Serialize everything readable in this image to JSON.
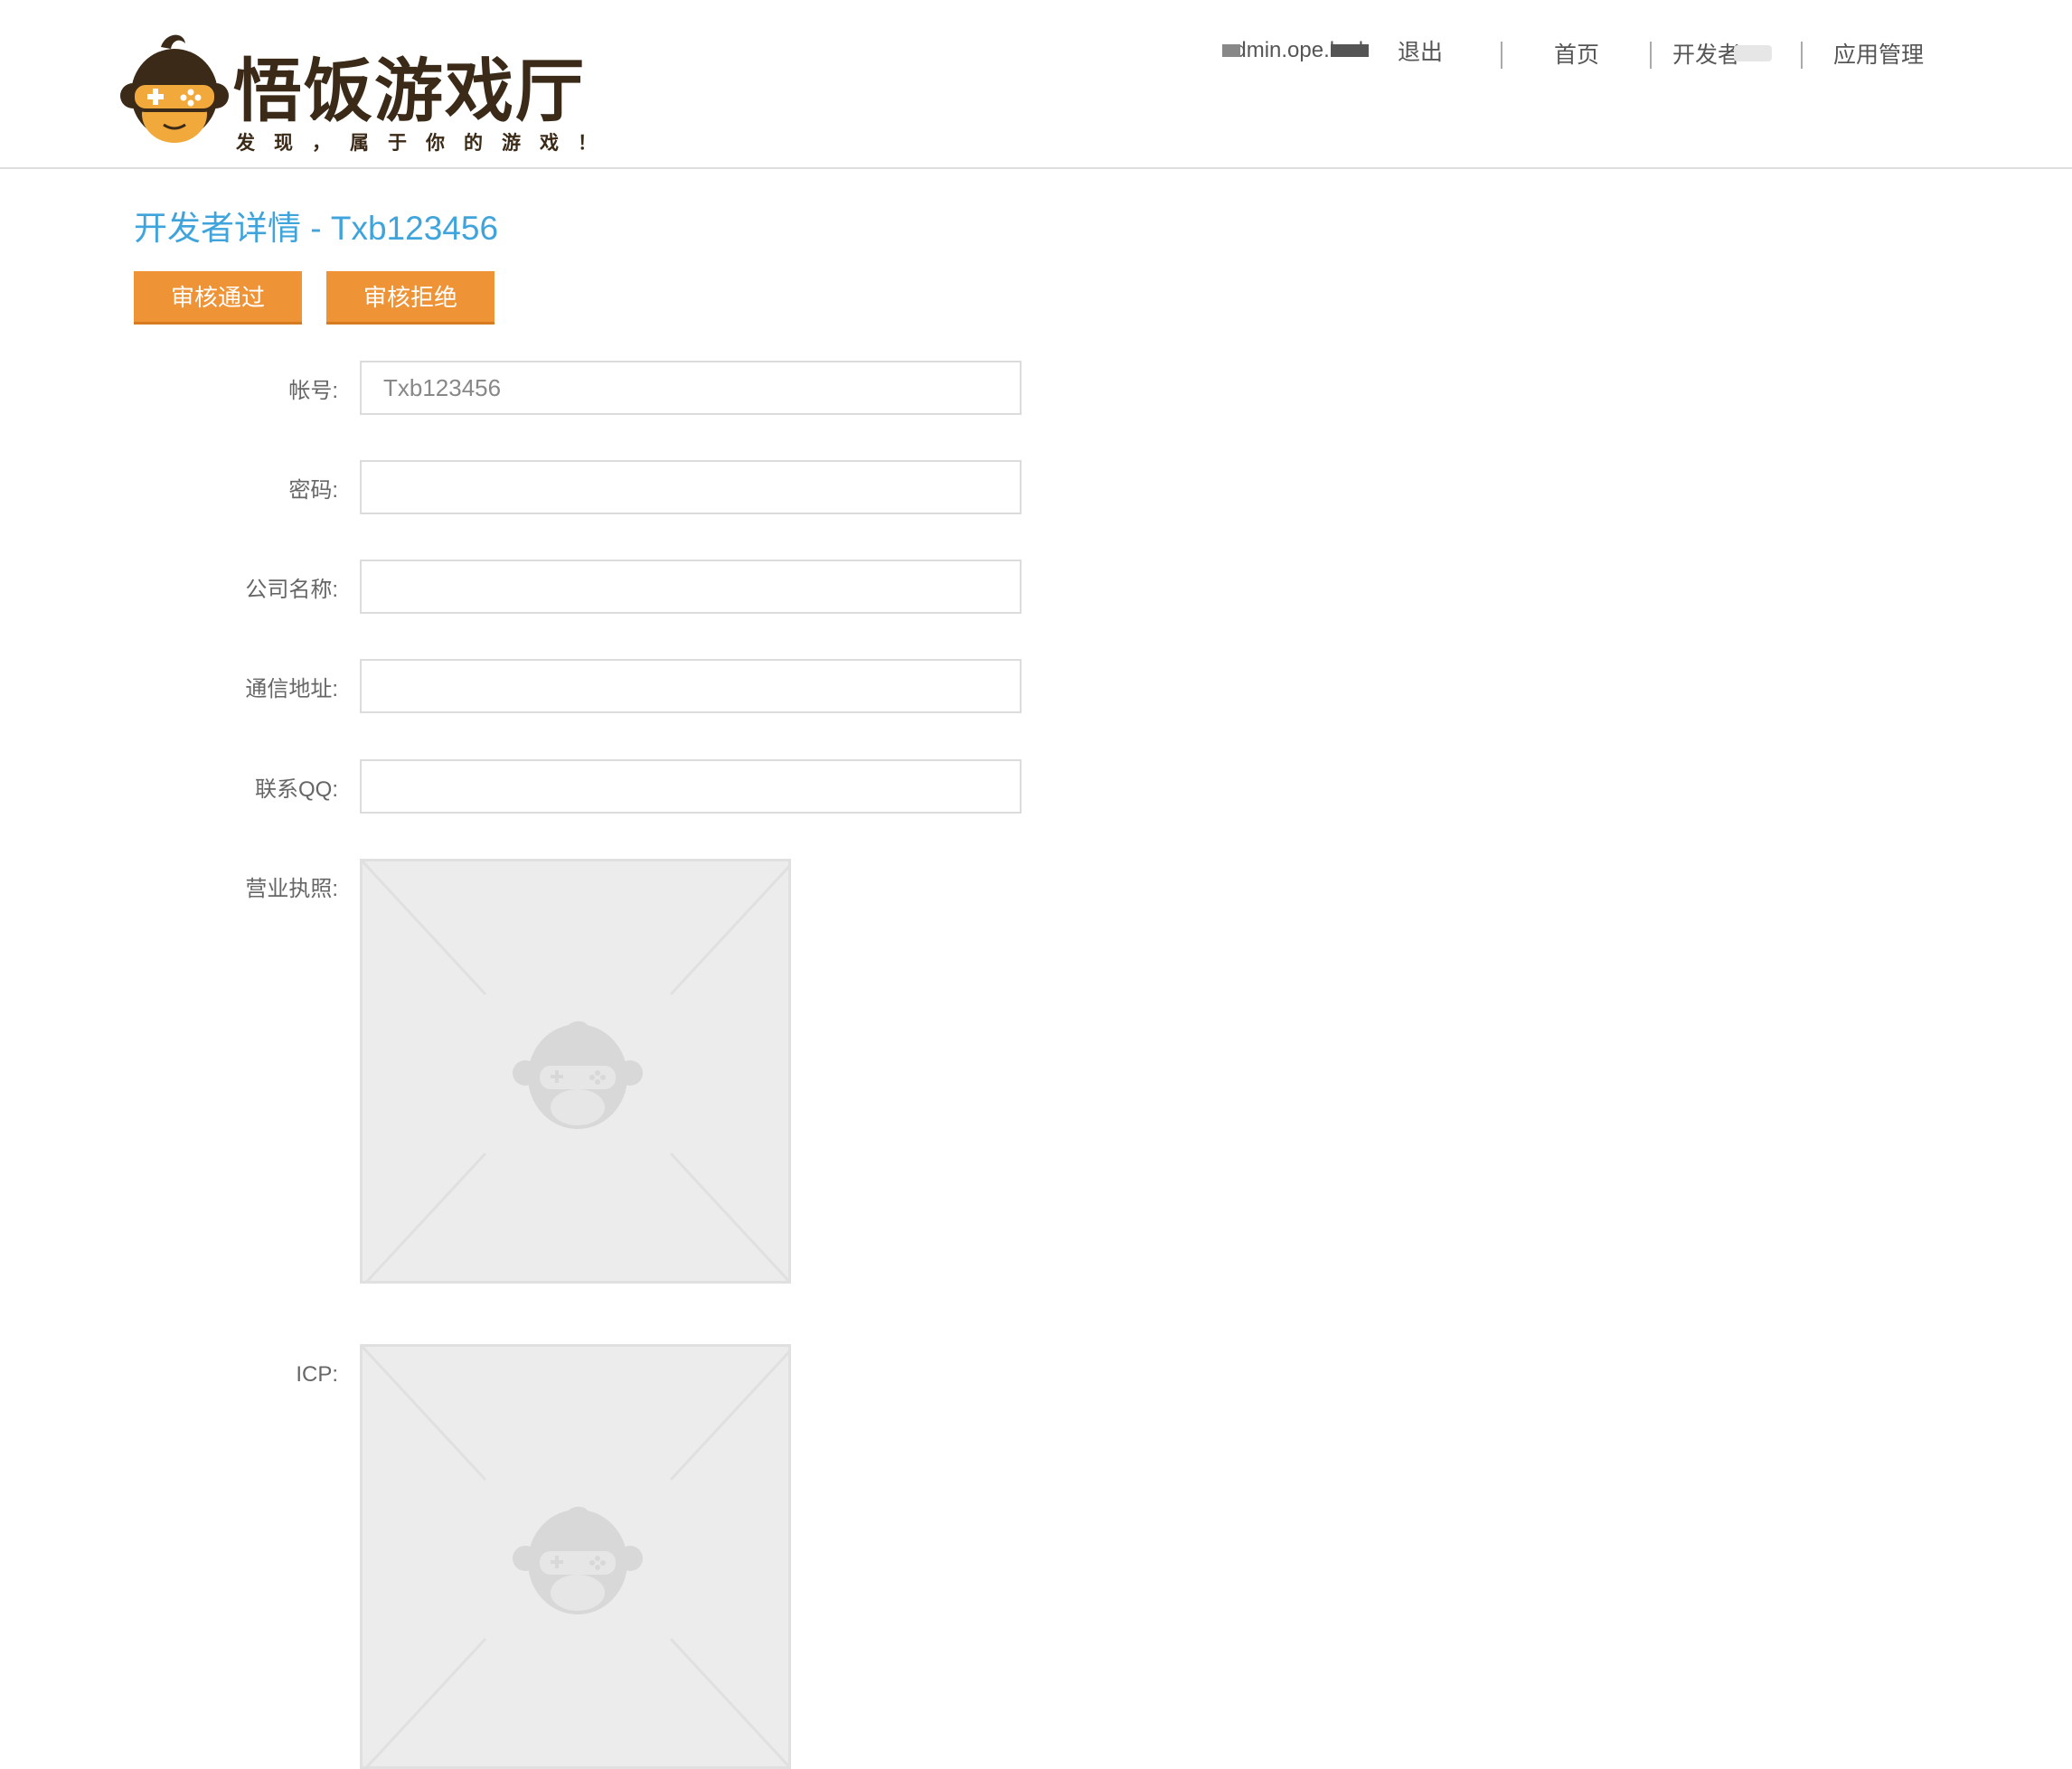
{
  "header": {
    "logo": {
      "title": "悟饭游戏厅",
      "slogan": "发现，属于你的游戏！"
    },
    "user": {
      "username": "admin.ope.leak",
      "logout_label": "退出"
    },
    "nav": [
      {
        "label": "首页"
      },
      {
        "label": "开发者"
      },
      {
        "label": "应用管理"
      }
    ]
  },
  "page": {
    "title": "开发者详情 - Txb123456",
    "buttons": {
      "approve_label": "审核通过",
      "reject_label": "审核拒绝"
    },
    "form": {
      "account": {
        "label": "帐号:",
        "value": "Txb123456"
      },
      "password": {
        "label": "密码:",
        "value": ""
      },
      "company": {
        "label": "公司名称:",
        "value": ""
      },
      "address": {
        "label": "通信地址:",
        "value": ""
      },
      "qq": {
        "label": "联系QQ:",
        "value": ""
      },
      "business_license": {
        "label": "营业执照:"
      },
      "icp": {
        "label": "ICP:"
      }
    }
  },
  "colors": {
    "accent_blue": "#3fa4db",
    "button_orange": "#ee9336",
    "logo_brown": "#3b2a17"
  }
}
